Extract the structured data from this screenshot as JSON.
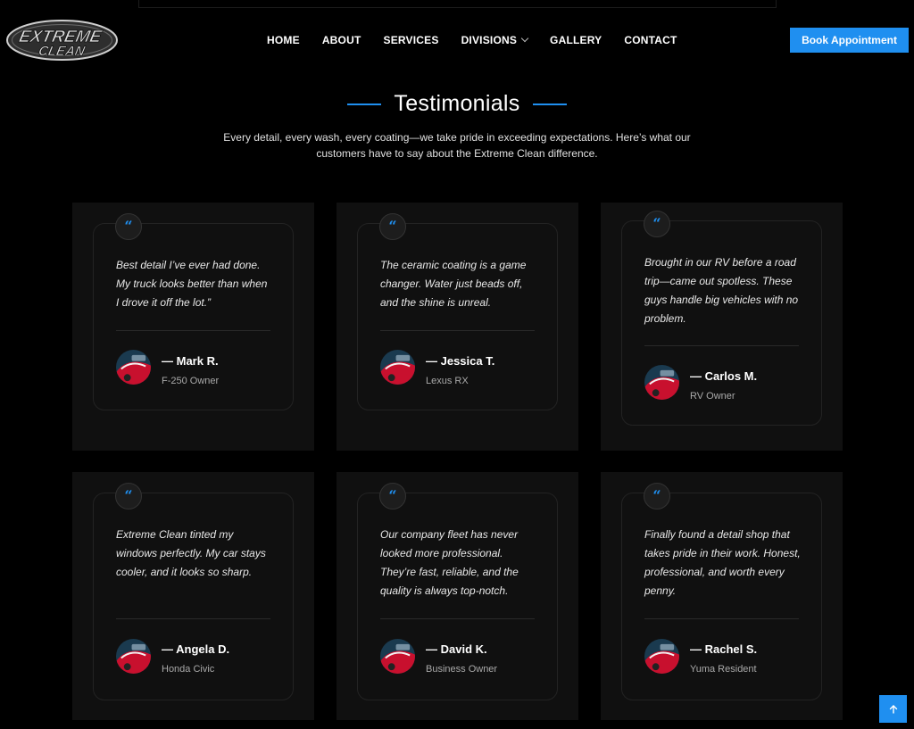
{
  "header": {
    "logo_alt": "Extreme Clean",
    "logo_line1": "EXTREME",
    "logo_line2": "CLEAN",
    "nav": [
      "HOME",
      "ABOUT",
      "SERVICES",
      "DIVISIONS",
      "GALLERY",
      "CONTACT"
    ],
    "book_label": "Book Appointment"
  },
  "section": {
    "title": "Testimonials",
    "subtitle": "Every detail, every wash, every coating—we take pride in exceeding expectations. Here’s what our customers have to say about the Extreme Clean difference."
  },
  "testimonials": [
    {
      "quote": "Best detail I’ve ever had done. My truck looks better than when I drove it off the lot.”",
      "author": "— Mark R.",
      "role": "F-250 Owner"
    },
    {
      "quote": "The ceramic coating is a game changer. Water just beads off, and the shine is unreal.",
      "author": "— Jessica T.",
      "role": "Lexus RX"
    },
    {
      "quote": "Brought in our RV before a road trip—came out spotless. These guys handle big vehicles with no problem.",
      "author": "— Carlos M.",
      "role": "RV Owner"
    },
    {
      "quote": "Extreme Clean tinted my windows perfectly. My car stays cooler, and it looks so sharp.",
      "author": "— Angela D.",
      "role": "Honda Civic"
    },
    {
      "quote": "Our company fleet has never looked more professional. They’re fast, reliable, and the quality is always top-notch.",
      "author": "— David K.",
      "role": "Business Owner"
    },
    {
      "quote": "Finally found a detail shop that takes pride in their work. Honest, professional, and worth every penny.",
      "author": "— Rachel S.",
      "role": "Yuma Resident"
    }
  ],
  "quote_glyph": "“",
  "icons": {
    "quote": "quote-icon",
    "avatar": "car-avatar",
    "scroll": "arrow-up-icon"
  },
  "colors": {
    "accent": "#1f8ff0",
    "card_bg": "#101010",
    "page_bg": "#000000"
  }
}
